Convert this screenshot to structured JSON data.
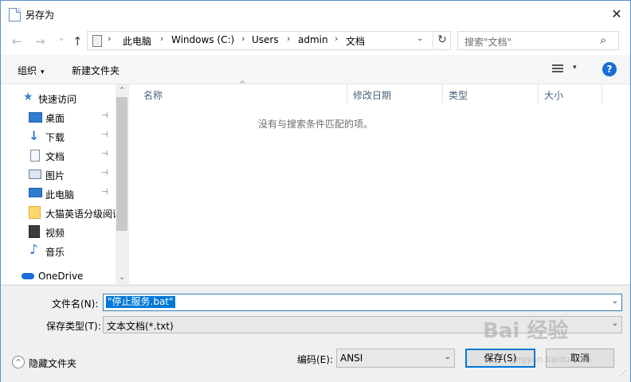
{
  "window": {
    "title": "另存为",
    "close": "✕"
  },
  "nav_buttons": {
    "back": "←",
    "forward": "→",
    "recent": "⌄",
    "up": "↑"
  },
  "address": {
    "crumbs": [
      "此电脑",
      "Windows (C:)",
      "Users",
      "admin",
      "文档"
    ],
    "separator": "›",
    "dropdown": "⌄",
    "refresh": "↻"
  },
  "search": {
    "placeholder": "搜索\"文档\"",
    "icon": "⌕"
  },
  "toolbar": {
    "organize": "组织",
    "caret": "▾",
    "new_folder": "新建文件夹",
    "view_caret": "▾",
    "help": "?"
  },
  "sidebar": {
    "items": [
      {
        "label": "快速访问",
        "icon": "star-icon"
      },
      {
        "label": "桌面",
        "icon": "desktop-icon",
        "pinned": true
      },
      {
        "label": "下载",
        "icon": "download-icon",
        "pinned": true
      },
      {
        "label": "文档",
        "icon": "document-icon",
        "pinned": true
      },
      {
        "label": "图片",
        "icon": "picture-icon",
        "pinned": true
      },
      {
        "label": "此电脑",
        "icon": "computer-icon",
        "pinned": true
      },
      {
        "label": "大猫英语分级阅读",
        "icon": "folder-icon"
      },
      {
        "label": "视频",
        "icon": "video-icon"
      },
      {
        "label": "音乐",
        "icon": "music-icon"
      },
      {
        "label": "OneDrive",
        "icon": "cloud-icon"
      }
    ],
    "pin": "⊣",
    "scroll_up": "⌃",
    "scroll_down": "⌄"
  },
  "columns": [
    "名称",
    "修改日期",
    "类型",
    "大小"
  ],
  "sort_indicator": "^",
  "empty_message": "没有与搜索条件匹配的项。",
  "footer": {
    "filename_label": "文件名(N):",
    "filename_value": "\"停止服务.bat\"",
    "filetype_label": "保存类型(T):",
    "filetype_value": "文本文档(*.txt)",
    "dropdown": "⌄",
    "hide_folders": "隐藏文件夹",
    "hide_toggle": "^",
    "encoding_label": "编码(E):",
    "encoding_value": "ANSI",
    "save": "保存(S)",
    "cancel": "取消",
    "grip": "⋰"
  },
  "watermark": {
    "brand": "Bai 经验",
    "url": "jingyan.baidu.com"
  },
  "colors": {
    "accent": "#0078d7",
    "help": "#1a6dd8",
    "border": "#5c8fc9"
  }
}
